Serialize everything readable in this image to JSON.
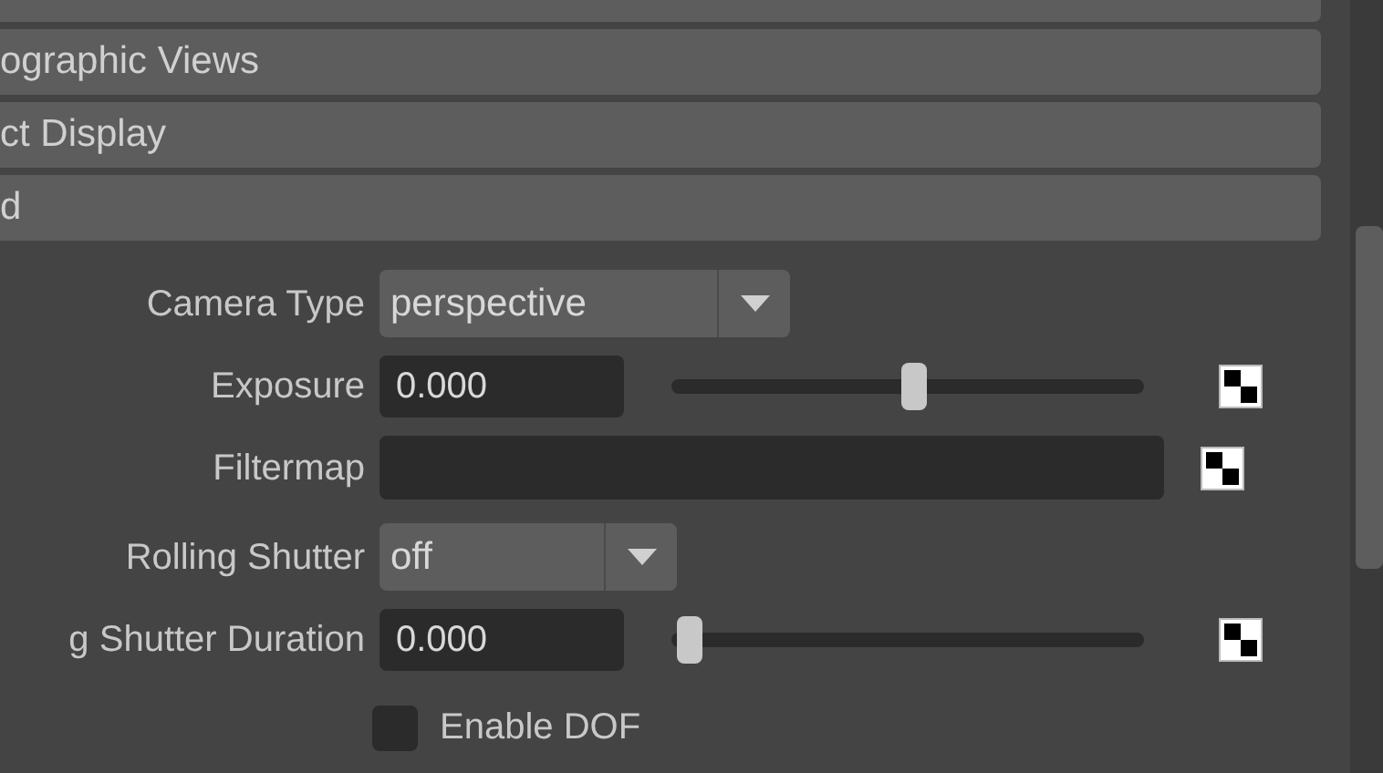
{
  "sections": [
    {
      "title": "ographic Views"
    },
    {
      "title": "ct Display"
    },
    {
      "title": "d"
    }
  ],
  "rows": [
    {
      "kind": "dropdown",
      "label": "Camera Type",
      "value": "perspective"
    },
    {
      "kind": "slider",
      "label": "Exposure",
      "value": "0.000",
      "level": 0.5
    },
    {
      "kind": "map",
      "label": "Filtermap"
    },
    {
      "kind": "divider"
    },
    {
      "kind": "dropdown",
      "label": "Rolling Shutter",
      "value": "off",
      "narrow": true
    },
    {
      "kind": "slider",
      "label": "g Shutter Duration",
      "value": "0.000",
      "level": 0
    },
    {
      "kind": "divider"
    },
    {
      "kind": "checkbox",
      "label": "Enable DOF",
      "checked": false
    }
  ]
}
